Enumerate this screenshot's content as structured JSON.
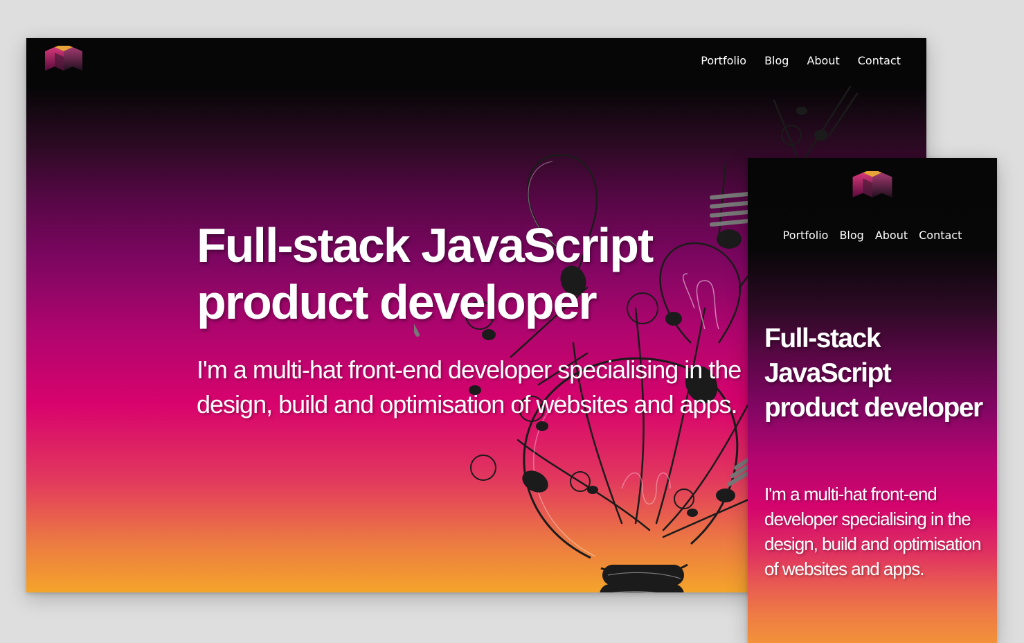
{
  "desktop": {
    "nav": {
      "items": [
        {
          "label": "Portfolio"
        },
        {
          "label": "Blog"
        },
        {
          "label": "About"
        },
        {
          "label": "Contact"
        }
      ]
    },
    "hero": {
      "title_line1": "Full-stack JavaScript",
      "title_line2": "product developer",
      "subtitle": "I'm a multi-hat front-end developer specialising in the design, build and optimisation of websites and apps."
    }
  },
  "mobile": {
    "nav": {
      "items": [
        {
          "label": "Portfolio"
        },
        {
          "label": "Blog"
        },
        {
          "label": "About"
        },
        {
          "label": "Contact"
        }
      ]
    },
    "hero": {
      "title": "Full-stack JavaScript product developer",
      "subtitle": "I'm a multi-hat front-end developer specialising in the design, build and optimisation of websites and apps."
    }
  },
  "colors": {
    "page_background": "#dedede",
    "header_black": "#060606",
    "gradient_purple": "#7d0661",
    "gradient_magenta": "#d8036d",
    "gradient_orange": "#f4a42b",
    "text": "#ffffff",
    "illustration_ink": "#1b1b1b"
  },
  "icons": {
    "logo": "m-cube-logo-icon",
    "illustration": "lightbulbs-illustration"
  }
}
